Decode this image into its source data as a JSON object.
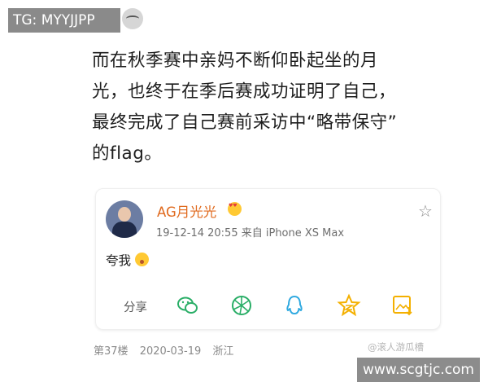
{
  "watermark_tag": "TG: MYYJJPP",
  "post_lines": [
    "而在秋季赛中亲妈不断仰卧起坐的月",
    "光，也终于在季后赛成功证明了自己，",
    "最终完成了自己赛前采访中“略带保守”",
    "的flag。"
  ],
  "quote": {
    "username": "AG月光光",
    "meta": "19-12-14 20:55  来自 iPhone XS Max",
    "text": "夸我",
    "share_label": "分享",
    "share_icons": [
      "wechat-icon",
      "moments-icon",
      "qq-icon",
      "qzone-icon",
      "save-image-icon"
    ]
  },
  "footer": {
    "floor": "第37楼",
    "date": "2020-03-19",
    "location": "浙江"
  },
  "source_watermark": "@滚人游瓜槽",
  "site_watermark": "www.scgtjc.com",
  "colors": {
    "username": "#e06a1e",
    "wechat": "#2aae67",
    "moments": "#2aae67",
    "qq": "#2fa9e0",
    "qzone": "#f4b000",
    "save": "#f4b000"
  }
}
